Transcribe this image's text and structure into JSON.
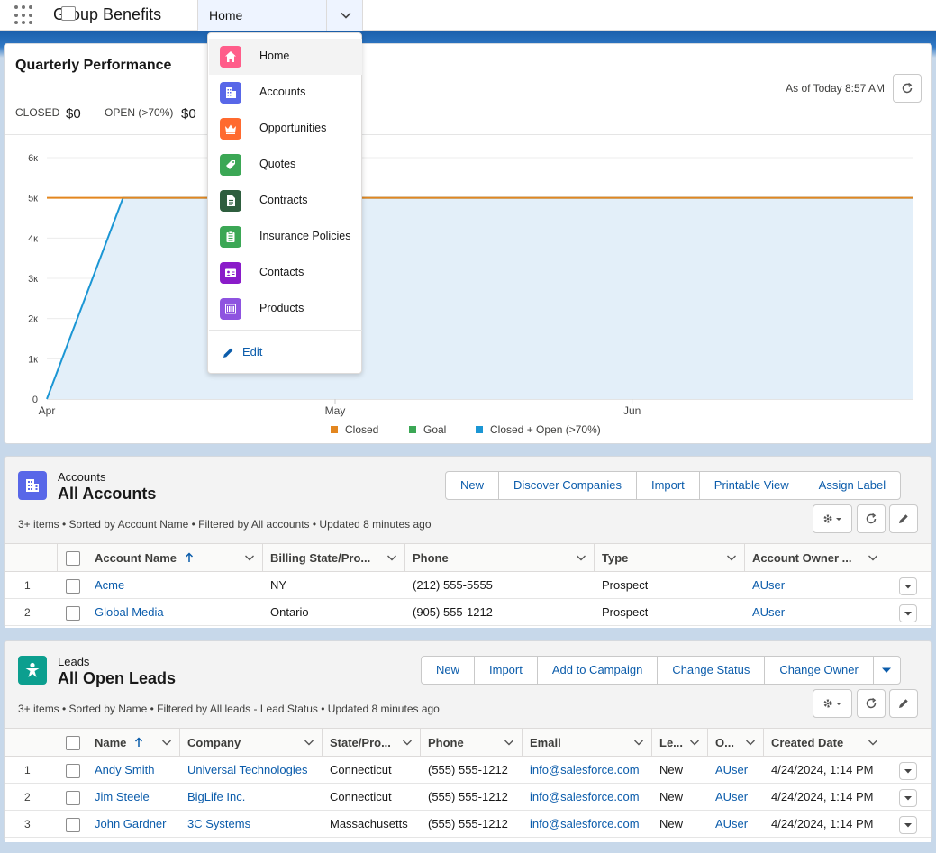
{
  "app": {
    "name": "Group Benefits"
  },
  "nav": {
    "current_tab": "Home"
  },
  "menu": {
    "items": [
      {
        "label": "Home",
        "icon": "home-icon",
        "color": "#ff5d8a"
      },
      {
        "label": "Accounts",
        "icon": "building-icon",
        "color": "#5867e8"
      },
      {
        "label": "Opportunities",
        "icon": "crown-icon",
        "color": "#ff6a2f"
      },
      {
        "label": "Quotes",
        "icon": "tag-icon",
        "color": "#3ba755"
      },
      {
        "label": "Contracts",
        "icon": "document-icon",
        "color": "#2e5e3e"
      },
      {
        "label": "Insurance Policies",
        "icon": "clipboard-icon",
        "color": "#3ba755"
      },
      {
        "label": "Contacts",
        "icon": "contact-card-icon",
        "color": "#8a1cc9"
      },
      {
        "label": "Products",
        "icon": "barcode-icon",
        "color": "#8e53e0"
      }
    ],
    "edit_label": "Edit"
  },
  "performance": {
    "title": "Quarterly Performance",
    "as_of": "As of Today 8:57 AM",
    "closed_label": "CLOSED",
    "closed_value": "$0",
    "open_label": "OPEN (>70%)",
    "open_value": "$0"
  },
  "chart_data": {
    "type": "line",
    "y_ticks": [
      "0",
      "1к",
      "2к",
      "3к",
      "4к",
      "5к",
      "6к"
    ],
    "ylim": [
      0,
      6000
    ],
    "x_ticks": [
      "Apr",
      "May",
      "Jun"
    ],
    "series": [
      {
        "name": "Closed",
        "color": "#e3861f",
        "values": [
          5000,
          5000
        ]
      },
      {
        "name": "Goal",
        "color": "#3ba755",
        "values": []
      },
      {
        "name": "Closed + Open (>70%)",
        "color": "#1b96d4",
        "values": [
          0,
          5000,
          5000
        ]
      }
    ],
    "legend": [
      "Closed",
      "Goal",
      "Closed + Open (>70%)"
    ],
    "legend_position": "bottom"
  },
  "accounts": {
    "object_label": "Accounts",
    "title": "All Accounts",
    "meta": "3+ items • Sorted by Account Name • Filtered by All accounts • Updated 8 minutes ago",
    "buttons": [
      "New",
      "Discover Companies",
      "Import",
      "Printable View",
      "Assign Label"
    ],
    "columns": [
      "Account Name",
      "Billing State/Pro...",
      "Phone",
      "Type",
      "Account Owner ..."
    ],
    "rows": [
      {
        "num": "1",
        "name": "Acme",
        "state": "NY",
        "phone": "(212) 555-5555",
        "type": "Prospect",
        "owner": "AUser"
      },
      {
        "num": "2",
        "name": "Global Media",
        "state": "Ontario",
        "phone": "(905) 555-1212",
        "type": "Prospect",
        "owner": "AUser"
      }
    ]
  },
  "leads": {
    "object_label": "Leads",
    "title": "All Open Leads",
    "meta": "3+ items • Sorted by Name • Filtered by All leads - Lead Status • Updated 8 minutes ago",
    "buttons": [
      "New",
      "Import",
      "Add to Campaign",
      "Change Status",
      "Change Owner"
    ],
    "columns": [
      "Name",
      "Company",
      "State/Pro...",
      "Phone",
      "Email",
      "Le...",
      "O...",
      "Created Date"
    ],
    "rows": [
      {
        "num": "1",
        "name": "Andy Smith",
        "company": "Universal Technologies",
        "state": "Connecticut",
        "phone": "(555) 555-1212",
        "email": "info@salesforce.com",
        "status": "New",
        "owner": "AUser",
        "created": "4/24/2024, 1:14 PM"
      },
      {
        "num": "2",
        "name": "Jim Steele",
        "company": "BigLife Inc.",
        "state": "Connecticut",
        "phone": "(555) 555-1212",
        "email": "info@salesforce.com",
        "status": "New",
        "owner": "AUser",
        "created": "4/24/2024, 1:14 PM"
      },
      {
        "num": "3",
        "name": "John Gardner",
        "company": "3C Systems",
        "state": "Massachusetts",
        "phone": "(555) 555-1212",
        "email": "info@salesforce.com",
        "status": "New",
        "owner": "AUser",
        "created": "4/24/2024, 1:14 PM"
      }
    ]
  }
}
